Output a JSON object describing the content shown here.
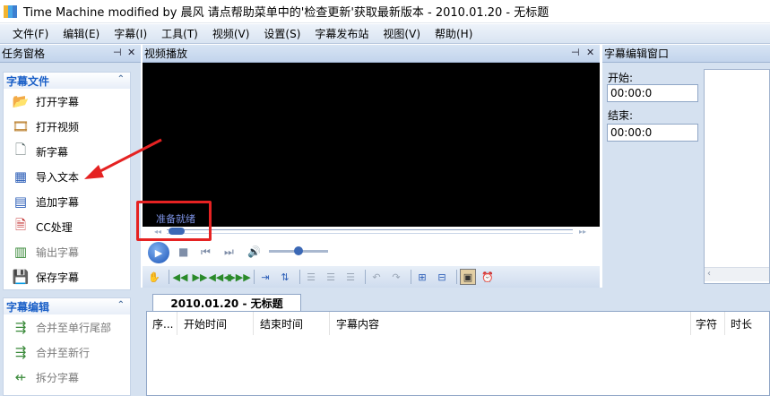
{
  "window": {
    "title": "Time Machine modified by 晨风 请点帮助菜单中的'检查更新'获取最新版本 - 2010.01.20 - 无标题"
  },
  "menu": [
    "文件(F)",
    "编辑(E)",
    "字幕(I)",
    "工具(T)",
    "视频(V)",
    "设置(S)",
    "字幕发布站",
    "视图(V)",
    "帮助(H)"
  ],
  "task_pane": {
    "title": "任务窗格",
    "pin": "ꟸ ✕",
    "groups": [
      {
        "title": "字幕文件",
        "items": [
          {
            "label": "打开字幕",
            "enabled": true
          },
          {
            "label": "打开视频",
            "enabled": true
          },
          {
            "label": "新字幕",
            "enabled": true
          },
          {
            "label": "导入文本",
            "enabled": true
          },
          {
            "label": "追加字幕",
            "enabled": true
          },
          {
            "label": "CC处理",
            "enabled": true
          },
          {
            "label": "输出字幕",
            "enabled": false
          },
          {
            "label": "保存字幕",
            "enabled": true
          }
        ]
      },
      {
        "title": "字幕编辑",
        "items": [
          {
            "label": "合并至单行尾部",
            "enabled": false
          },
          {
            "label": "合并至新行",
            "enabled": false
          },
          {
            "label": "拆分字幕",
            "enabled": false
          }
        ]
      }
    ]
  },
  "video_panel": {
    "title": "视频播放",
    "status": "准备就绪",
    "seek_position": 0.01,
    "volume": 0.45
  },
  "subtitle_editor": {
    "title": "字幕编辑窗口",
    "start_label": "开始:",
    "start_value": "00:00:0",
    "end_label": "结束:",
    "end_value": "00:00:0"
  },
  "document": {
    "tab": "2010.01.20 - 无标题",
    "columns": [
      "序...",
      "开始时间",
      "结束时间",
      "字幕内容",
      "字符",
      "时长"
    ]
  },
  "colors": {
    "accent": "#1a5fc7",
    "highlight": "#e52222",
    "pane_bg": "#d5e1f0"
  }
}
